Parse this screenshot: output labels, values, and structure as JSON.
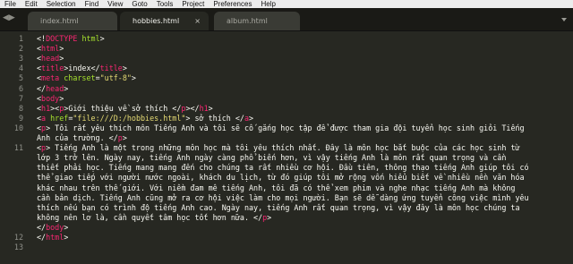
{
  "menubar": {
    "items": [
      "File",
      "Edit",
      "Selection",
      "Find",
      "View",
      "Goto",
      "Tools",
      "Project",
      "Preferences",
      "Help"
    ]
  },
  "tabs": [
    {
      "label": "index.html",
      "active": false
    },
    {
      "label": "hobbies.html",
      "active": true
    },
    {
      "label": "album.html",
      "active": false
    }
  ],
  "tab_close_glyph": "×",
  "editor": {
    "line_numbers": [
      "1",
      "2",
      "3",
      "4",
      "5",
      "6",
      "7",
      "8",
      "9",
      "10",
      "",
      "11",
      "",
      "",
      "",
      "",
      "",
      "",
      "",
      "",
      "12",
      "13"
    ],
    "lines": [
      [
        {
          "c": "txt",
          "t": "<!"
        },
        {
          "c": "tag",
          "t": "DOCTYPE"
        },
        {
          "c": "txt",
          "t": " "
        },
        {
          "c": "attr",
          "t": "html"
        },
        {
          "c": "txt",
          "t": ">"
        }
      ],
      [
        {
          "c": "txt",
          "t": "<"
        },
        {
          "c": "tag",
          "t": "html"
        },
        {
          "c": "txt",
          "t": ">"
        }
      ],
      [
        {
          "c": "txt",
          "t": "<"
        },
        {
          "c": "tag",
          "t": "head"
        },
        {
          "c": "txt",
          "t": ">"
        }
      ],
      [
        {
          "c": "txt",
          "t": "<"
        },
        {
          "c": "tag",
          "t": "title"
        },
        {
          "c": "txt",
          "t": ">index</"
        },
        {
          "c": "tag",
          "t": "title"
        },
        {
          "c": "txt",
          "t": ">"
        }
      ],
      [
        {
          "c": "txt",
          "t": "<"
        },
        {
          "c": "tag",
          "t": "meta"
        },
        {
          "c": "txt",
          "t": " "
        },
        {
          "c": "attr",
          "t": "charset"
        },
        {
          "c": "txt",
          "t": "="
        },
        {
          "c": "str",
          "t": "\"utf-8\""
        },
        {
          "c": "txt",
          "t": ">"
        }
      ],
      [
        {
          "c": "txt",
          "t": "</"
        },
        {
          "c": "tag",
          "t": "head"
        },
        {
          "c": "txt",
          "t": ">"
        }
      ],
      [
        {
          "c": "txt",
          "t": "<"
        },
        {
          "c": "tag",
          "t": "body"
        },
        {
          "c": "txt",
          "t": ">"
        }
      ],
      [
        {
          "c": "txt",
          "t": "<"
        },
        {
          "c": "tag",
          "t": "h1"
        },
        {
          "c": "txt",
          "t": "><"
        },
        {
          "c": "tag",
          "t": "p"
        },
        {
          "c": "txt",
          "t": ">Giới thiệu về sở thích </"
        },
        {
          "c": "tag",
          "t": "p"
        },
        {
          "c": "txt",
          "t": "></"
        },
        {
          "c": "tag",
          "t": "h1"
        },
        {
          "c": "txt",
          "t": ">"
        }
      ],
      [
        {
          "c": "txt",
          "t": "<"
        },
        {
          "c": "tag",
          "t": "a"
        },
        {
          "c": "txt",
          "t": " "
        },
        {
          "c": "attr",
          "t": "href"
        },
        {
          "c": "txt",
          "t": "="
        },
        {
          "c": "str",
          "t": "\"file:///D:/hobbies.html\""
        },
        {
          "c": "txt",
          "t": "> sở thích </"
        },
        {
          "c": "tag",
          "t": "a"
        },
        {
          "c": "txt",
          "t": ">"
        }
      ],
      [
        {
          "c": "txt",
          "t": "<"
        },
        {
          "c": "tag",
          "t": "p"
        },
        {
          "c": "txt",
          "t": "> Tôi rất yêu thích môn Tiếng Anh và tôi sẽ cố gắng học tập để được tham gia đội tuyển học sinh giỏi Tiếng"
        }
      ],
      [
        {
          "c": "txt",
          "t": "Anh của trường. </"
        },
        {
          "c": "tag",
          "t": "p"
        },
        {
          "c": "txt",
          "t": ">"
        }
      ],
      [
        {
          "c": "txt",
          "t": "<"
        },
        {
          "c": "tag",
          "t": "p"
        },
        {
          "c": "txt",
          "t": "> Tiếng Anh là một trong những môn học mà tôi yêu thích nhất. Đây là môn học bắt buộc của các học sinh từ"
        }
      ],
      [
        {
          "c": "txt",
          "t": "lớp 3 trở lên. Ngày nay, tiếng Anh ngày càng phổ biến hơn, vì vậy tiếng Anh là môn rất quan trọng và cần"
        }
      ],
      [
        {
          "c": "txt",
          "t": "thiết phải học. Tiếng mang mang đến cho chúng ta rất nhiều cơ hội. Đầu tiên, thông thạo tiếng Anh giúp tôi có"
        }
      ],
      [
        {
          "c": "txt",
          "t": "thể giao tiếp với người nước ngoài, khách du lịch, từ đó giúp tôi mở rộng vốn hiểu biết về nhiều nền văn hóa"
        }
      ],
      [
        {
          "c": "txt",
          "t": "khác nhau trên thế giới. Với niềm đam mê tiếng Anh, tôi đã có thể xem phim và nghe nhạc tiếng Anh mà không"
        }
      ],
      [
        {
          "c": "txt",
          "t": "cần bản dịch. Tiếng Anh cũng mở ra cơ hội việc làm cho mọi người. Bạn sẽ dễ dàng ứng tuyển công việc mình yêu"
        }
      ],
      [
        {
          "c": "txt",
          "t": "thích nếu bạn có trình độ tiếng Anh cao. Ngày nay, tiếng Anh rất quan trọng, vì vậy đây là môn học chúng ta"
        }
      ],
      [
        {
          "c": "txt",
          "t": "không nên lơ là, cần quyết tâm học tốt hơn nữa. </"
        },
        {
          "c": "tag",
          "t": "p"
        },
        {
          "c": "txt",
          "t": ">"
        }
      ],
      [
        {
          "c": "txt",
          "t": "</"
        },
        {
          "c": "tag",
          "t": "body"
        },
        {
          "c": "txt",
          "t": ">"
        }
      ],
      [
        {
          "c": "txt",
          "t": "</"
        },
        {
          "c": "tag",
          "t": "html"
        },
        {
          "c": "txt",
          "t": ">"
        }
      ]
    ],
    "line_for_number": [
      0,
      1,
      2,
      3,
      4,
      5,
      6,
      7,
      8,
      9,
      -1,
      11,
      -1,
      -1,
      -1,
      -1,
      -1,
      -1,
      -1,
      -1,
      19,
      20
    ],
    "colors": {
      "background": "#272822",
      "tag": "#f92672",
      "attribute": "#a6e22e",
      "string": "#e6db74",
      "text": "#f8f8f2",
      "gutter_text": "#8f908a"
    }
  }
}
